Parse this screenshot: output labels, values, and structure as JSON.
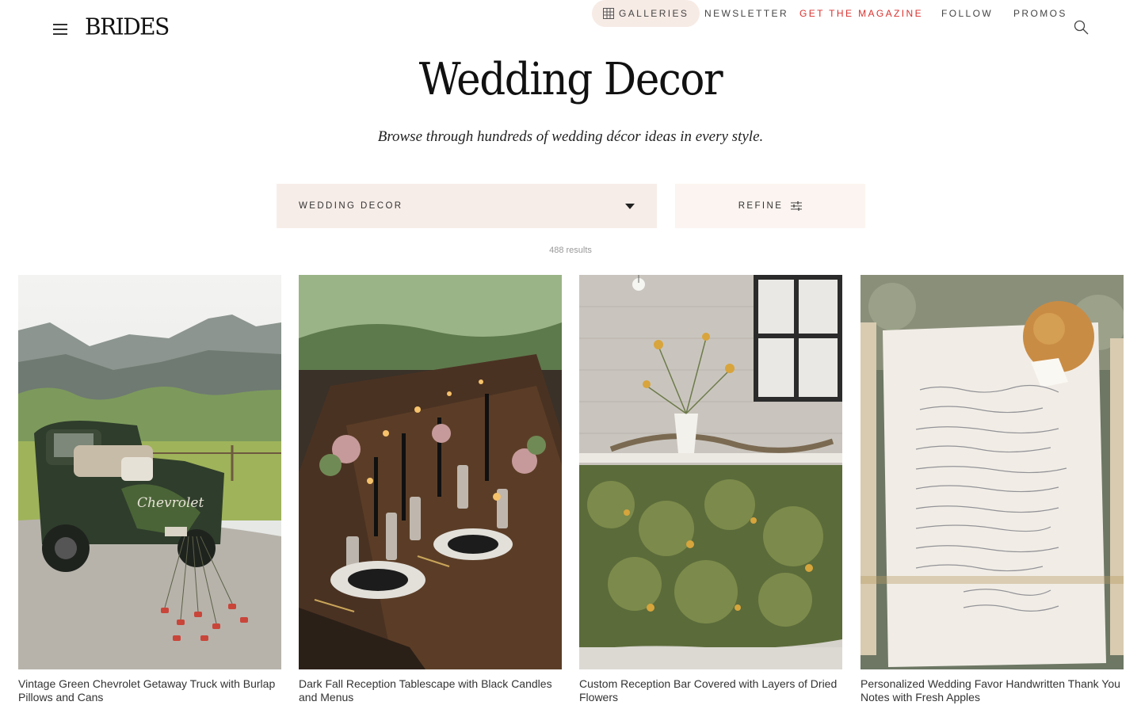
{
  "header": {
    "logo": "BRIDES",
    "nav": {
      "galleries": "GALLERIES",
      "newsletter": "NEWSLETTER",
      "magazine": "GET THE MAGAZINE",
      "follow": "FOLLOW",
      "promos": "PROMOS"
    }
  },
  "page": {
    "title": "Wedding Decor",
    "subtitle": "Browse through hundreds of wedding décor ideas in every style."
  },
  "filters": {
    "category_selected": "WEDDING DECOR",
    "refine_label": "REFINE"
  },
  "results_count": "488 results",
  "cards": [
    {
      "title": "Vintage Green Chevrolet Getaway Truck with Burlap Pillows and Cans",
      "truck_text": "Chevrolet"
    },
    {
      "title": "Dark Fall Reception Tablescape with Black Candles and Menus"
    },
    {
      "title": "Custom Reception Bar Covered with Layers of Dried Flowers"
    },
    {
      "title": "Personalized Wedding Favor Handwritten Thank You Notes with Fresh Apples"
    }
  ],
  "colors": {
    "accent_red": "#d9322f",
    "chip_bg": "#f7ebe6",
    "select_bg": "#f7ede8"
  }
}
